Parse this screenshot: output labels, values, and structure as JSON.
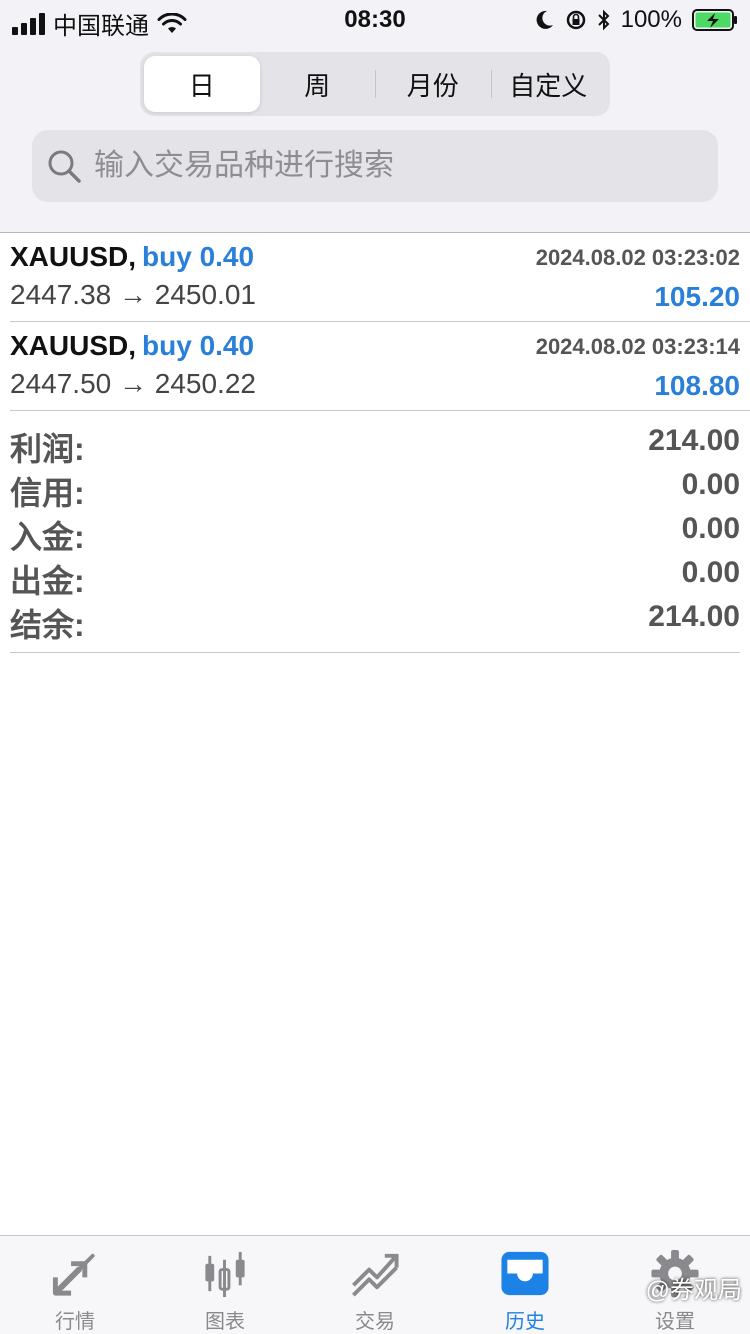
{
  "status_bar": {
    "carrier": "中国联通",
    "time": "08:30",
    "battery": "100%"
  },
  "period_tabs": [
    {
      "label": "日",
      "active": true
    },
    {
      "label": "周",
      "active": false
    },
    {
      "label": "月份",
      "active": false
    },
    {
      "label": "自定义",
      "active": false
    }
  ],
  "search": {
    "placeholder": "输入交易品种进行搜索",
    "value": ""
  },
  "trades": [
    {
      "symbol": "XAUUSD,",
      "side": "buy 0.40",
      "time": "2024.08.02 03:23:02",
      "prices": "2447.38 → 2450.01",
      "profit": "105.20"
    },
    {
      "symbol": "XAUUSD,",
      "side": "buy 0.40",
      "time": "2024.08.02 03:23:14",
      "prices": "2447.50 → 2450.22",
      "profit": "108.80"
    }
  ],
  "summary": [
    {
      "label": "利润:",
      "value": "214.00"
    },
    {
      "label": "信用:",
      "value": "0.00"
    },
    {
      "label": "入金:",
      "value": "0.00"
    },
    {
      "label": "出金:",
      "value": "0.00"
    },
    {
      "label": "结余:",
      "value": "214.00"
    }
  ],
  "tabbar": [
    {
      "label": "行情",
      "icon": "quotes-arrows-icon",
      "active": false
    },
    {
      "label": "图表",
      "icon": "candlestick-chart-icon",
      "active": false
    },
    {
      "label": "交易",
      "icon": "trade-trend-icon",
      "active": false
    },
    {
      "label": "历史",
      "icon": "history-inbox-icon",
      "active": true
    },
    {
      "label": "设置",
      "icon": "gear-icon",
      "active": false
    }
  ],
  "watermark": "@券观局",
  "colors": {
    "accent": "#1d82e6",
    "buy_text": "#2a7fd9",
    "header_bg": "#f2f2f7"
  }
}
